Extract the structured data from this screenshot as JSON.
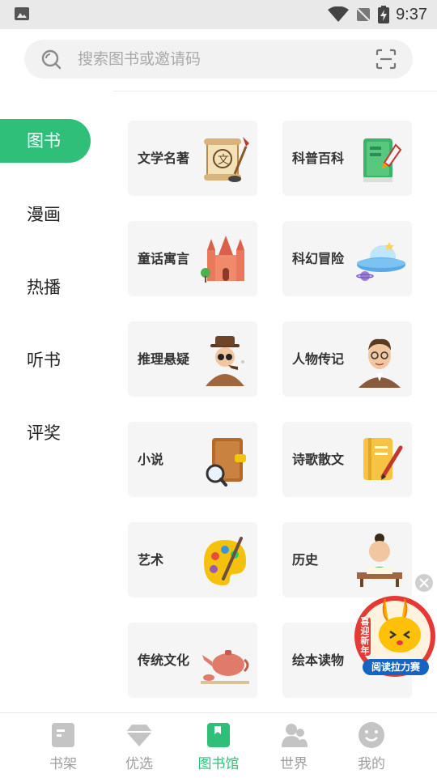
{
  "status_bar": {
    "time": "9:37"
  },
  "search": {
    "placeholder": "搜索图书或邀请码"
  },
  "sidebar": {
    "items": [
      {
        "label": "图书",
        "active": true
      },
      {
        "label": "漫画",
        "active": false
      },
      {
        "label": "热播",
        "active": false
      },
      {
        "label": "听书",
        "active": false
      },
      {
        "label": "评奖",
        "active": false
      }
    ]
  },
  "categories": [
    {
      "label": "文学名著",
      "icon": "scroll-quill-icon"
    },
    {
      "label": "科普百科",
      "icon": "rocket-book-icon"
    },
    {
      "label": "童话寓言",
      "icon": "castle-icon"
    },
    {
      "label": "科幻冒险",
      "icon": "ufo-icon"
    },
    {
      "label": "推理悬疑",
      "icon": "detective-icon"
    },
    {
      "label": "人物传记",
      "icon": "portrait-icon"
    },
    {
      "label": "小说",
      "icon": "magnifier-book-icon"
    },
    {
      "label": "诗歌散文",
      "icon": "notebook-pen-icon"
    },
    {
      "label": "艺术",
      "icon": "palette-icon"
    },
    {
      "label": "历史",
      "icon": "scholar-icon"
    },
    {
      "label": "传统文化",
      "icon": "teapot-icon"
    },
    {
      "label": "绘本读物",
      "icon": "picture-book-icon"
    }
  ],
  "promo": {
    "side_text": "喜迎新年",
    "banner_text": "阅读拉力赛"
  },
  "bottom_nav": [
    {
      "label": "书架",
      "icon": "bookshelf-icon",
      "active": false
    },
    {
      "label": "优选",
      "icon": "diamond-icon",
      "active": false
    },
    {
      "label": "图书馆",
      "icon": "library-icon",
      "active": true
    },
    {
      "label": "世界",
      "icon": "people-icon",
      "active": false
    },
    {
      "label": "我的",
      "icon": "smiley-icon",
      "active": false
    }
  ],
  "colors": {
    "accent": "#2fbf79",
    "card_bg": "#f5f5f5",
    "inactive": "#9e9e9e"
  }
}
